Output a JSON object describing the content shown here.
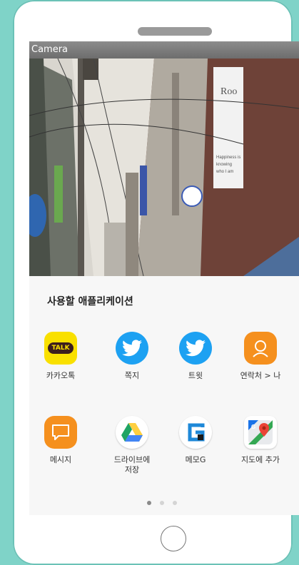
{
  "window": {
    "title": "Camera"
  },
  "share_sheet": {
    "title": "사용할 애플리케이션",
    "apps": [
      {
        "label": "카카오톡",
        "icon": "kakaotalk-icon",
        "badge": "TALK",
        "color": "#f9e000"
      },
      {
        "label": "쪽지",
        "icon": "twitter-icon",
        "color": "#1da1f2"
      },
      {
        "label": "트윗",
        "icon": "twitter-icon",
        "color": "#1da1f2"
      },
      {
        "label": "연락처 > 나",
        "icon": "contact-icon",
        "color": "#f5901e"
      },
      {
        "label": "메시지",
        "icon": "message-icon",
        "color": "#f5901e"
      },
      {
        "label": "드라이브에\n저장",
        "icon": "google-drive-icon",
        "color": "#ffffff"
      },
      {
        "label": "메모G",
        "icon": "memo-g-icon",
        "color": "#ffffff"
      },
      {
        "label": "지도에 추가",
        "icon": "google-maps-icon",
        "color": "#ffffff"
      }
    ],
    "pagination": {
      "pages": 3,
      "current": 1
    }
  },
  "photo": {
    "sign_text": "Roof\nHappiness is\nknowing\nwho I am"
  }
}
